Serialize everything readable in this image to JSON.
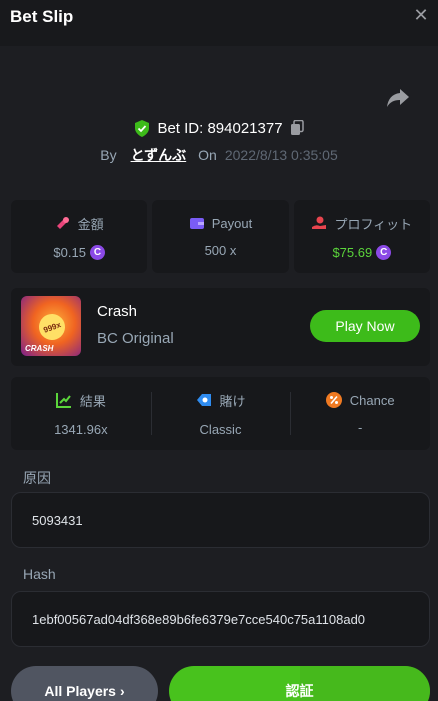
{
  "header": {
    "title": "Bet Slip"
  },
  "bet": {
    "id_label": "Bet ID: 894021377",
    "by_label": "By",
    "user": "とずんぶ",
    "on_label": "On",
    "time": "2022/8/13 0:35:05"
  },
  "stats": [
    {
      "label": "金額",
      "value": "$0.15",
      "icon": "coin-bag-icon"
    },
    {
      "label": "Payout",
      "value": "500 x",
      "icon": "wallet-icon"
    },
    {
      "label": "プロフィット",
      "value": "$75.69",
      "icon": "profit-icon"
    }
  ],
  "coin_symbol": "C",
  "game": {
    "thumb_badge": "999x",
    "thumb_tag": "CRASH",
    "name": "Crash",
    "provider": "BC Original",
    "play_label": "Play Now"
  },
  "result": [
    {
      "label": "結果",
      "value": "1341.96x",
      "icon": "chart-icon"
    },
    {
      "label": "賭け",
      "value": "Classic",
      "icon": "bet-icon"
    },
    {
      "label": "Chance",
      "value": "-",
      "icon": "percent-icon"
    }
  ],
  "seed": {
    "label": "原因",
    "value": "5093431"
  },
  "hash": {
    "label": "Hash",
    "value": "1ebf00567ad04df368e89b6fe6379e7cce540c75a1108ad0"
  },
  "buttons": {
    "all_players": "All Players",
    "all_players_arrow": "›",
    "verify": "認証"
  },
  "colors": {
    "accent_green": "#3dbb1a",
    "profit_green": "#5bd53b",
    "coin_purple": "#8b49e6",
    "panel": "#17181b"
  }
}
